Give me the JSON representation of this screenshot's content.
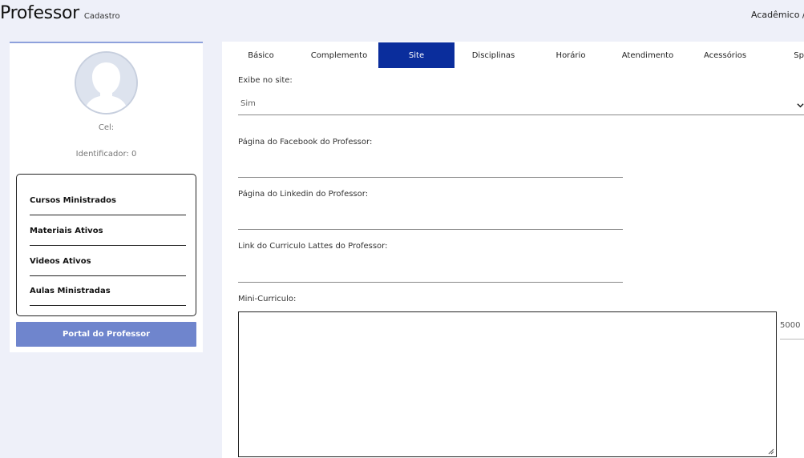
{
  "header": {
    "title": "Professor",
    "subtitle": "Cadastro",
    "breadcrumb": "Acadêmico /"
  },
  "profile": {
    "cel_label": "Cel:",
    "identifier": "Identificador: 0",
    "stats": [
      "Cursos Ministrados",
      "Materiais Ativos",
      "Videos Ativos",
      "Aulas Ministradas"
    ],
    "portal_button": "Portal do Professor"
  },
  "tabs": [
    "Básico",
    "Complemento",
    "Site",
    "Disciplinas",
    "Horário",
    "Atendimento",
    "Acessórios",
    "Sp"
  ],
  "active_tab": "Site",
  "form": {
    "exibe_label": "Exibe no site:",
    "exibe_value": "Sim",
    "facebook_label": "Página do Facebook do Professor:",
    "facebook_value": "",
    "linkedin_label": "Página do Linkedin do Professor:",
    "linkedin_value": "",
    "lattes_label": "Link do Curriculo Lattes do Professor:",
    "lattes_value": "",
    "mini_label": "Mini-Curriculo:",
    "mini_value": "",
    "counter": "5000"
  },
  "colors": {
    "accent": "#0a2d9c",
    "button": "#6f85cd",
    "background": "#eef0f9"
  }
}
